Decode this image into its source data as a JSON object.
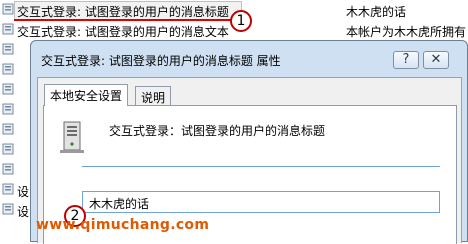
{
  "list": {
    "rows": [
      {
        "name": "交互式登录: 试图登录的用户的消息标题",
        "value": "木木虎的话"
      },
      {
        "name": "交互式登录: 试图登录的用户的消息文本",
        "value": "本帐户为木木虎所拥有"
      },
      {
        "name": "",
        "value": ""
      },
      {
        "name": "",
        "value": ""
      },
      {
        "name": "",
        "value": ""
      },
      {
        "name": "",
        "value": ""
      },
      {
        "name": "",
        "value": ""
      },
      {
        "name": "",
        "value": ""
      },
      {
        "name": "",
        "value": ""
      },
      {
        "name": "设",
        "value": ""
      },
      {
        "name": "设",
        "value": ""
      }
    ]
  },
  "dialog": {
    "title": "交互式登录: 试图登录的用户的消息标题 属性",
    "help_button": "?",
    "close_button": "✕",
    "tabs": [
      {
        "label": "本地安全设置",
        "active": true
      },
      {
        "label": "说明",
        "active": false
      }
    ],
    "policy_name": "交互式登录：试图登录的用户的消息标题",
    "value": "木木虎的话"
  },
  "callouts": {
    "first": "1",
    "second": "2"
  },
  "watermark": "www.qimuchang.com",
  "colors": {
    "accent_red": "#e00000",
    "dialog_frame": "#cfe0f2",
    "input_border": "#6fa3d7"
  }
}
